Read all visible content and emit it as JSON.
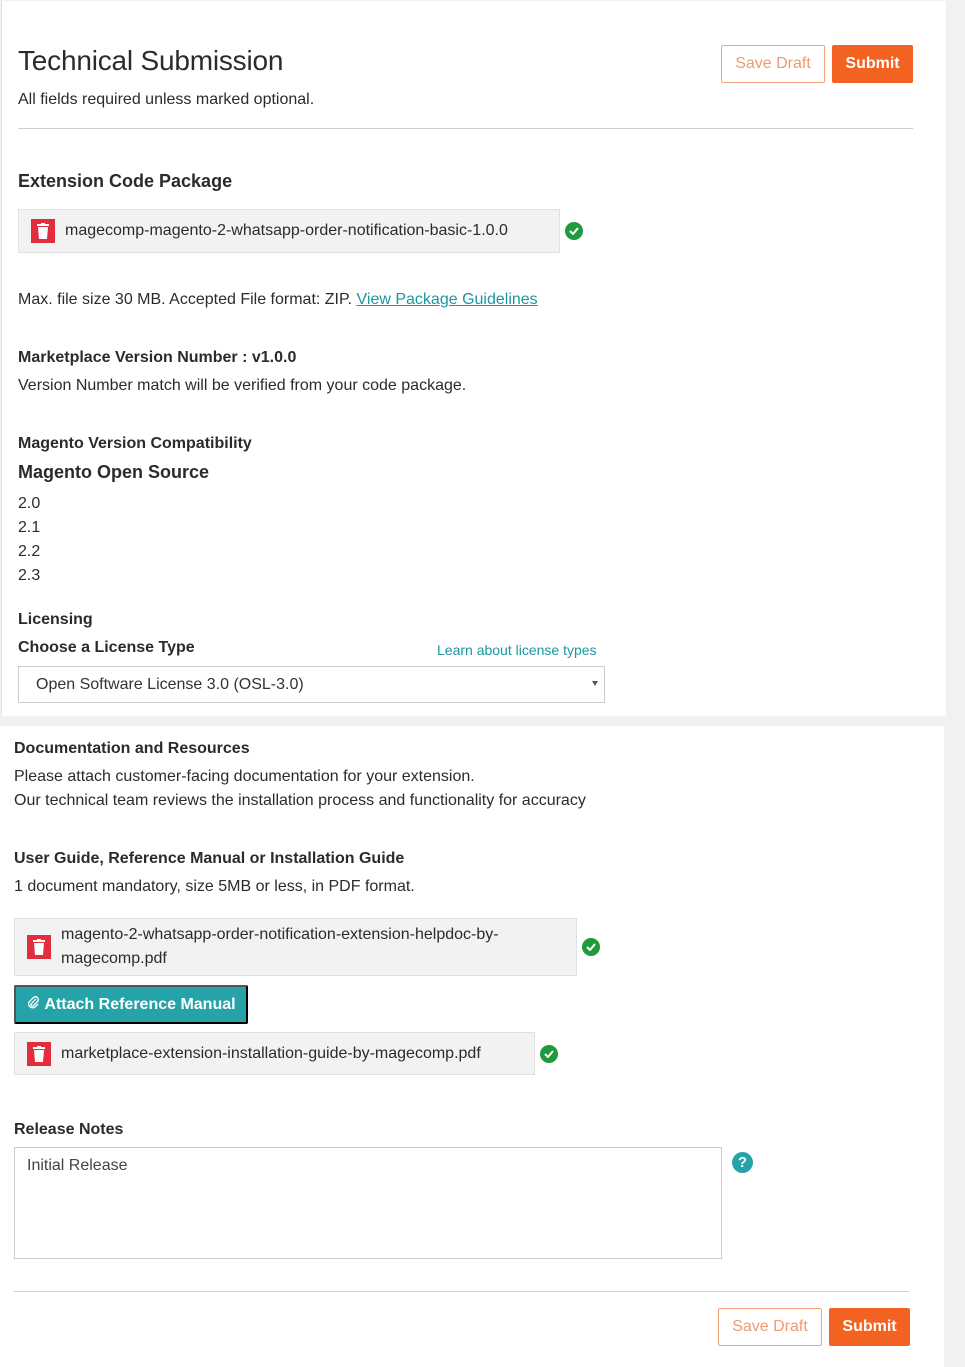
{
  "header": {
    "title": "Technical Submission",
    "subtitle": "All fields required unless marked optional.",
    "save_draft_label": "Save Draft",
    "submit_label": "Submit"
  },
  "extension_package": {
    "heading": "Extension Code Package",
    "file_name": "magecomp-magento-2-whatsapp-order-notification-basic-1.0.0",
    "file_status": "uploaded",
    "info_text": "Max. file size 30 MB. Accepted File format: ZIP.",
    "guidelines_link": "View Package Guidelines"
  },
  "version": {
    "label": "Marketplace Version Number : v1.0.0",
    "note": "Version Number match will be verified from your code package."
  },
  "compatibility": {
    "heading": "Magento Version Compatibility",
    "edition": "Magento Open Source",
    "versions": [
      "2.0",
      "2.1",
      "2.2",
      "2.3"
    ]
  },
  "licensing": {
    "heading": "Licensing",
    "label": "Choose a License Type",
    "learn_link": "Learn about license types",
    "selected": "Open Software License 3.0 (OSL-3.0)"
  },
  "documentation": {
    "heading": "Documentation and Resources",
    "line1": "Please attach customer-facing documentation for your extension.",
    "line2": "Our technical team reviews the installation process and functionality for accuracy",
    "guide_heading": "User Guide, Reference Manual or Installation Guide",
    "guide_note": "1 document mandatory, size 5MB or less, in PDF format.",
    "files": [
      {
        "name_line1": "magento-2-whatsapp-order-notification-extension-helpdoc-by-",
        "name_line2": "magecomp.pdf",
        "status": "uploaded"
      },
      {
        "name_line1": "marketplace-extension-installation-guide-by-magecomp.pdf",
        "name_line2": "",
        "status": "uploaded"
      }
    ],
    "attach_label": "Attach Reference Manual"
  },
  "release_notes": {
    "heading": "Release Notes",
    "value": "Initial Release",
    "help_symbol": "?"
  },
  "footer": {
    "save_draft_label": "Save Draft",
    "submit_label": "Submit"
  },
  "colors": {
    "accent_orange": "#f26322",
    "accent_teal": "#26a3a9",
    "delete_red": "#e22d3c",
    "success_green": "#1f9b3b"
  }
}
